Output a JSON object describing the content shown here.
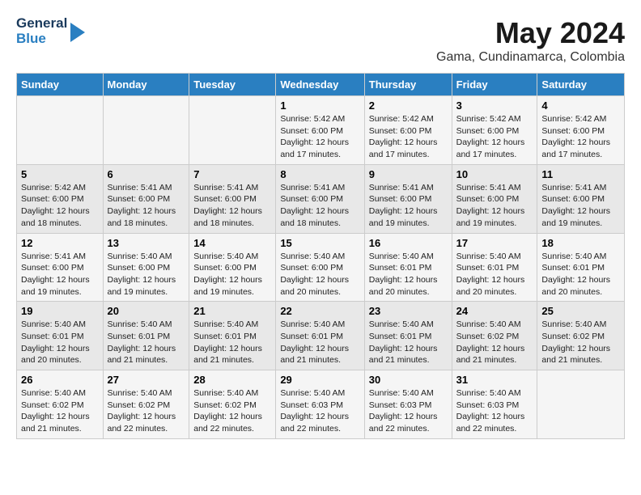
{
  "logo": {
    "line1": "General",
    "line2": "Blue"
  },
  "title": "May 2024",
  "subtitle": "Gama, Cundinamarca, Colombia",
  "headers": [
    "Sunday",
    "Monday",
    "Tuesday",
    "Wednesday",
    "Thursday",
    "Friday",
    "Saturday"
  ],
  "weeks": [
    [
      {
        "day": "",
        "info": ""
      },
      {
        "day": "",
        "info": ""
      },
      {
        "day": "",
        "info": ""
      },
      {
        "day": "1",
        "info": "Sunrise: 5:42 AM\nSunset: 6:00 PM\nDaylight: 12 hours\nand 17 minutes."
      },
      {
        "day": "2",
        "info": "Sunrise: 5:42 AM\nSunset: 6:00 PM\nDaylight: 12 hours\nand 17 minutes."
      },
      {
        "day": "3",
        "info": "Sunrise: 5:42 AM\nSunset: 6:00 PM\nDaylight: 12 hours\nand 17 minutes."
      },
      {
        "day": "4",
        "info": "Sunrise: 5:42 AM\nSunset: 6:00 PM\nDaylight: 12 hours\nand 17 minutes."
      }
    ],
    [
      {
        "day": "5",
        "info": "Sunrise: 5:42 AM\nSunset: 6:00 PM\nDaylight: 12 hours\nand 18 minutes."
      },
      {
        "day": "6",
        "info": "Sunrise: 5:41 AM\nSunset: 6:00 PM\nDaylight: 12 hours\nand 18 minutes."
      },
      {
        "day": "7",
        "info": "Sunrise: 5:41 AM\nSunset: 6:00 PM\nDaylight: 12 hours\nand 18 minutes."
      },
      {
        "day": "8",
        "info": "Sunrise: 5:41 AM\nSunset: 6:00 PM\nDaylight: 12 hours\nand 18 minutes."
      },
      {
        "day": "9",
        "info": "Sunrise: 5:41 AM\nSunset: 6:00 PM\nDaylight: 12 hours\nand 19 minutes."
      },
      {
        "day": "10",
        "info": "Sunrise: 5:41 AM\nSunset: 6:00 PM\nDaylight: 12 hours\nand 19 minutes."
      },
      {
        "day": "11",
        "info": "Sunrise: 5:41 AM\nSunset: 6:00 PM\nDaylight: 12 hours\nand 19 minutes."
      }
    ],
    [
      {
        "day": "12",
        "info": "Sunrise: 5:41 AM\nSunset: 6:00 PM\nDaylight: 12 hours\nand 19 minutes."
      },
      {
        "day": "13",
        "info": "Sunrise: 5:40 AM\nSunset: 6:00 PM\nDaylight: 12 hours\nand 19 minutes."
      },
      {
        "day": "14",
        "info": "Sunrise: 5:40 AM\nSunset: 6:00 PM\nDaylight: 12 hours\nand 19 minutes."
      },
      {
        "day": "15",
        "info": "Sunrise: 5:40 AM\nSunset: 6:00 PM\nDaylight: 12 hours\nand 20 minutes."
      },
      {
        "day": "16",
        "info": "Sunrise: 5:40 AM\nSunset: 6:01 PM\nDaylight: 12 hours\nand 20 minutes."
      },
      {
        "day": "17",
        "info": "Sunrise: 5:40 AM\nSunset: 6:01 PM\nDaylight: 12 hours\nand 20 minutes."
      },
      {
        "day": "18",
        "info": "Sunrise: 5:40 AM\nSunset: 6:01 PM\nDaylight: 12 hours\nand 20 minutes."
      }
    ],
    [
      {
        "day": "19",
        "info": "Sunrise: 5:40 AM\nSunset: 6:01 PM\nDaylight: 12 hours\nand 20 minutes."
      },
      {
        "day": "20",
        "info": "Sunrise: 5:40 AM\nSunset: 6:01 PM\nDaylight: 12 hours\nand 21 minutes."
      },
      {
        "day": "21",
        "info": "Sunrise: 5:40 AM\nSunset: 6:01 PM\nDaylight: 12 hours\nand 21 minutes."
      },
      {
        "day": "22",
        "info": "Sunrise: 5:40 AM\nSunset: 6:01 PM\nDaylight: 12 hours\nand 21 minutes."
      },
      {
        "day": "23",
        "info": "Sunrise: 5:40 AM\nSunset: 6:01 PM\nDaylight: 12 hours\nand 21 minutes."
      },
      {
        "day": "24",
        "info": "Sunrise: 5:40 AM\nSunset: 6:02 PM\nDaylight: 12 hours\nand 21 minutes."
      },
      {
        "day": "25",
        "info": "Sunrise: 5:40 AM\nSunset: 6:02 PM\nDaylight: 12 hours\nand 21 minutes."
      }
    ],
    [
      {
        "day": "26",
        "info": "Sunrise: 5:40 AM\nSunset: 6:02 PM\nDaylight: 12 hours\nand 21 minutes."
      },
      {
        "day": "27",
        "info": "Sunrise: 5:40 AM\nSunset: 6:02 PM\nDaylight: 12 hours\nand 22 minutes."
      },
      {
        "day": "28",
        "info": "Sunrise: 5:40 AM\nSunset: 6:02 PM\nDaylight: 12 hours\nand 22 minutes."
      },
      {
        "day": "29",
        "info": "Sunrise: 5:40 AM\nSunset: 6:03 PM\nDaylight: 12 hours\nand 22 minutes."
      },
      {
        "day": "30",
        "info": "Sunrise: 5:40 AM\nSunset: 6:03 PM\nDaylight: 12 hours\nand 22 minutes."
      },
      {
        "day": "31",
        "info": "Sunrise: 5:40 AM\nSunset: 6:03 PM\nDaylight: 12 hours\nand 22 minutes."
      },
      {
        "day": "",
        "info": ""
      }
    ]
  ]
}
